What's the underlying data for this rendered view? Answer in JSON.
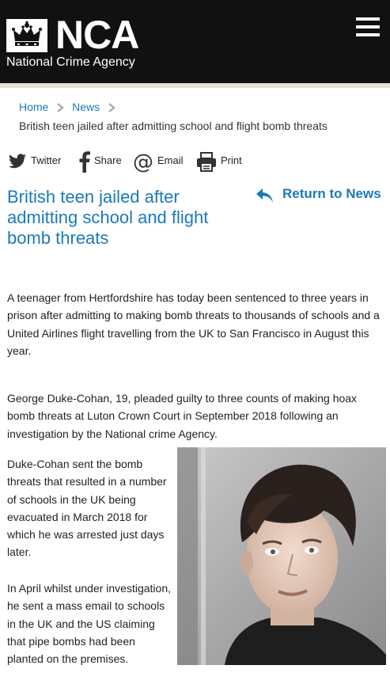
{
  "header": {
    "logo_text": "NCA",
    "logo_subtitle": "National Crime Agency",
    "menu_icon": "hamburger-menu-icon"
  },
  "breadcrumb": {
    "items": [
      "Home",
      "News"
    ],
    "current": "British teen jailed after admitting school and flight bomb threats"
  },
  "share": {
    "twitter": "Twitter",
    "share": "Share",
    "email": "Email",
    "print": "Print"
  },
  "article": {
    "title": "British teen jailed after admitting school and flight bomb threats",
    "return_label": "Return to News",
    "paragraphs": [
      "A teenager from Hertfordshire has today been sentenced to three years in prison after admitting to making bomb threats to thousands of schools and a United Airlines flight travelling from the UK to San Francisco in August this year.",
      "George Duke-Cohan, 19, pleaded guilty to three counts of making hoax bomb threats at Luton Crown Court in September 2018 following an investigation by the National crime Agency.",
      "Duke-Cohan sent the bomb threats that resulted in a number of schools in the UK being evacuated in March 2018 for which he was arrested just days later.",
      "In April whilst under investigation, he sent a mass email to schools in the UK and the US claiming that pipe bombs had been planted on the premises."
    ]
  },
  "colors": {
    "header_bg": "#111111",
    "accent": "#1b7ab8",
    "band": "#e5e0d3"
  }
}
